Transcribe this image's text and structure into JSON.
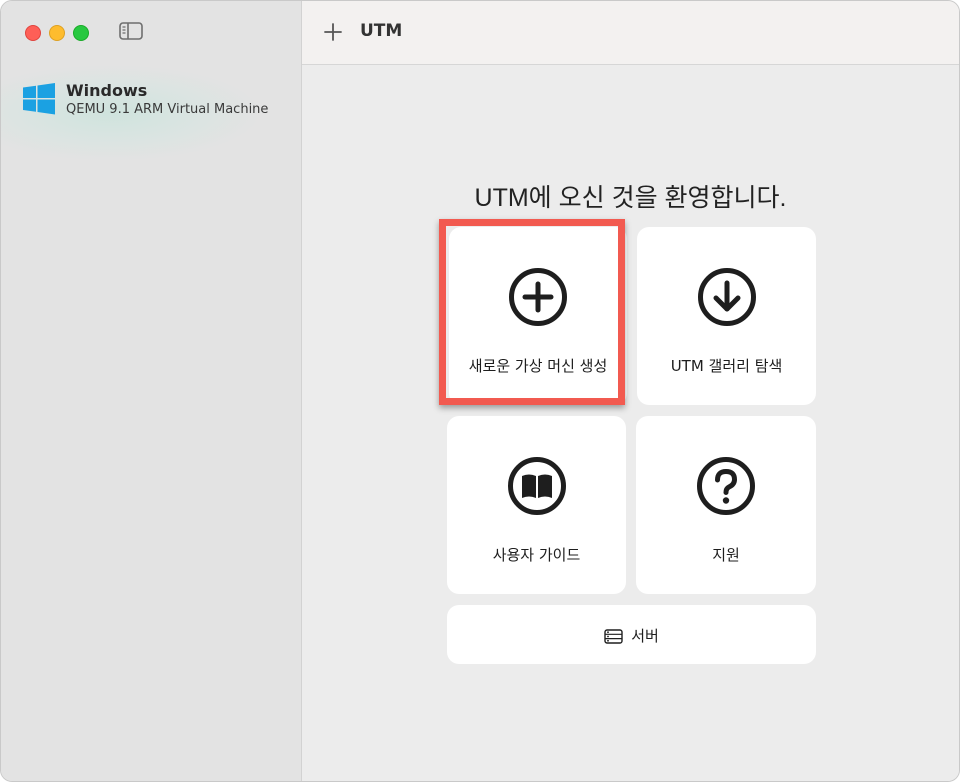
{
  "window": {
    "toolbar_title": "UTM"
  },
  "sidebar": {
    "vms": [
      {
        "name": "Windows",
        "description": "QEMU 9.1 ARM Virtual Machine",
        "icon": "windows-logo-icon"
      }
    ]
  },
  "main": {
    "welcome_title": "UTM에 오신 것을 환영합니다.",
    "cards": {
      "create": {
        "label": "새로운 가상 머신 생성",
        "icon": "plus-circle-icon"
      },
      "gallery": {
        "label": "UTM 갤러리 탐색",
        "icon": "download-circle-icon"
      },
      "guide": {
        "label": "사용자 가이드",
        "icon": "book-icon"
      },
      "support": {
        "label": "지원",
        "icon": "question-circle-icon"
      },
      "server": {
        "label": "서버",
        "icon": "server-icon"
      }
    }
  },
  "colors": {
    "highlight": "#f25a50",
    "windows_logo": "#1ba1e2",
    "close": "#fe5f57",
    "minimize": "#febc2e",
    "maximize": "#28c840"
  }
}
